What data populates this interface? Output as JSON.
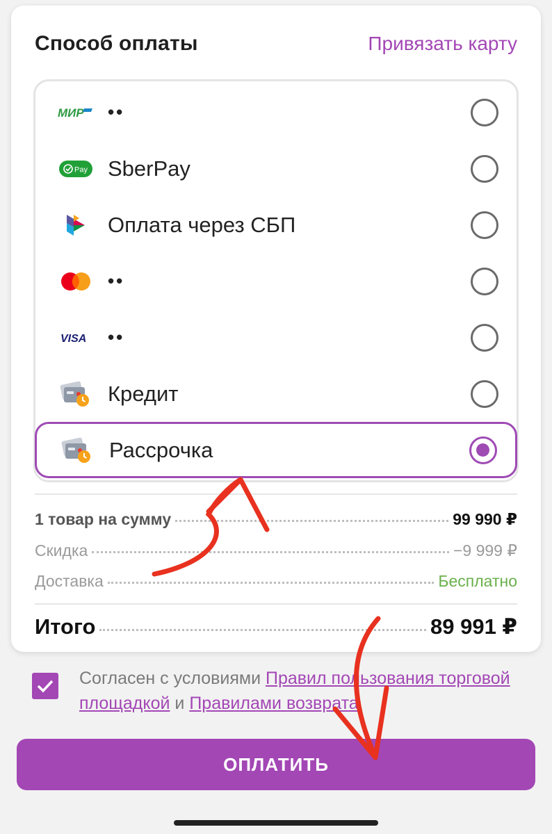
{
  "header": {
    "title": "Способ оплаты",
    "link_card": "Привязать карту"
  },
  "methods": [
    {
      "icon": "mir-logo-icon",
      "brand": "МИР",
      "label": "••",
      "selected": false
    },
    {
      "icon": "sberpay-logo-icon",
      "brand": "Pay",
      "label": "SberPay",
      "selected": false
    },
    {
      "icon": "sbp-logo-icon",
      "label": "Оплата через СБП",
      "selected": false
    },
    {
      "icon": "mastercard-logo-icon",
      "label": "••",
      "selected": false
    },
    {
      "icon": "visa-logo-icon",
      "brand": "VISA",
      "label": "••",
      "selected": false
    },
    {
      "icon": "credit-card-clock-icon",
      "label": "Кредит",
      "selected": false
    },
    {
      "icon": "credit-card-clock-icon",
      "label": "Рассрочка",
      "selected": true
    }
  ],
  "summary": {
    "items_label": "1 товар на сумму",
    "items_value": "99 990 ₽",
    "discount_label": "Скидка",
    "discount_value": "−9 999 ₽",
    "delivery_label": "Доставка",
    "delivery_value": "Бесплатно",
    "total_label": "Итого",
    "total_value": "89 991 ₽"
  },
  "agreement": {
    "checked": true,
    "text_before": "Согласен с условиями ",
    "link_rules": "Правил пользования торговой площадкой",
    "text_and": " и ",
    "link_return": "Правилами возврата"
  },
  "pay_button": "ОПЛАТИТЬ",
  "colors": {
    "accent": "#a347b5",
    "free_delivery": "#6ab04c",
    "annotation_arrow": "#e8311f"
  }
}
